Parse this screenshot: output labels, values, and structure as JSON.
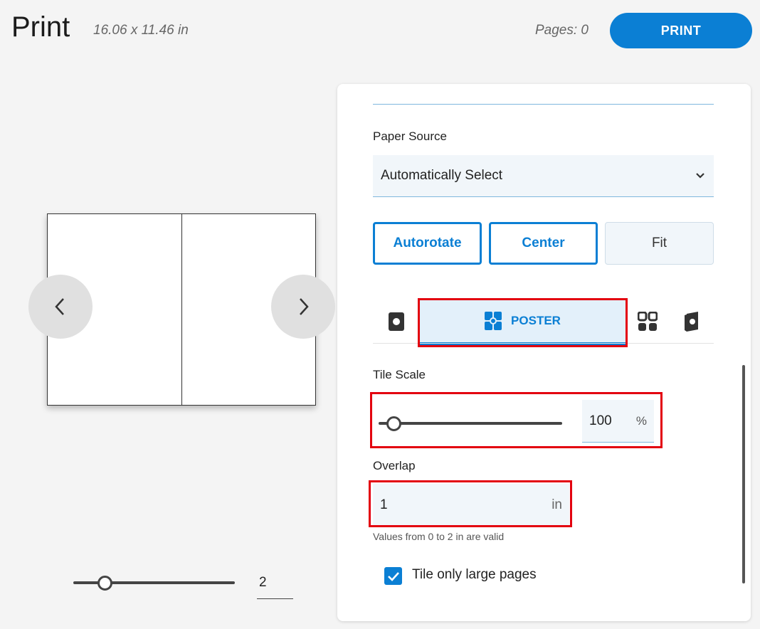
{
  "header": {
    "title": "Print",
    "dimensions": "16.06 x 11.46 in",
    "pages": "Pages: 0",
    "print_label": "PRINT"
  },
  "preview": {
    "zoom_value": "2",
    "zoom_level_fraction": 0.2
  },
  "panel": {
    "paper_source_label": "Paper Source",
    "paper_source_value": "Automatically Select",
    "buttons": {
      "autorotate": "Autorotate",
      "center": "Center",
      "fit": "Fit"
    },
    "tabs": {
      "poster_label": "POSTER",
      "icons": [
        "single-page-icon",
        "poster-icon",
        "grid-icon",
        "booklet-icon"
      ]
    },
    "tile_scale_label": "Tile Scale",
    "tile_scale_value": "100",
    "tile_scale_unit": "%",
    "tile_scale_fraction": 0.0,
    "overlap_label": "Overlap",
    "overlap_value": "1",
    "overlap_unit": "in",
    "overlap_hint": "Values from 0 to 2 in are valid",
    "tile_only_large_label": "Tile only large pages",
    "tile_only_large_checked": true
  },
  "colors": {
    "accent": "#0b7fd4",
    "highlight": "#e3000f",
    "background": "#f4f4f4"
  }
}
